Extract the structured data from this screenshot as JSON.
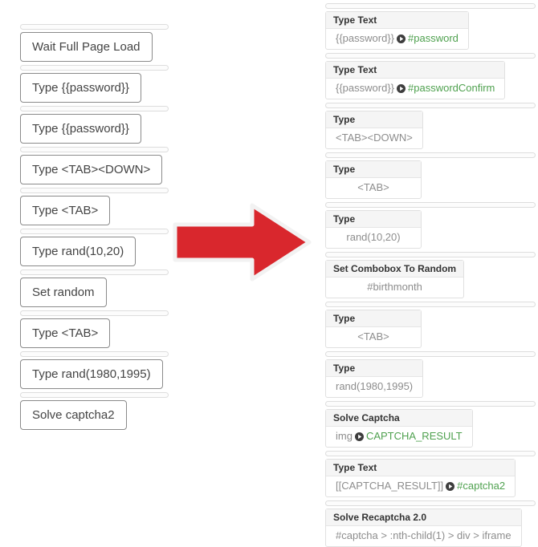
{
  "left_panel": {
    "name": "simple-step-list",
    "steps": [
      {
        "label": "Wait Full Page Load"
      },
      {
        "label": "Type {{password}}"
      },
      {
        "label": "Type {{password}}"
      },
      {
        "label": "Type <TAB><DOWN>"
      },
      {
        "label": "Type <TAB>"
      },
      {
        "label": "Type rand(10,20)"
      },
      {
        "label": "Set random"
      },
      {
        "label": "Type <TAB>"
      },
      {
        "label": "Type rand(1980,1995)"
      },
      {
        "label": "Solve captcha2"
      }
    ]
  },
  "arrow": {
    "name": "red-right-arrow",
    "direction": "right",
    "color": "#d9272d"
  },
  "right_panel": {
    "name": "detailed-step-list",
    "steps": [
      {
        "title": "Type Text",
        "value": "{{password}}",
        "icon": "arrow-circle-right-icon",
        "selector": "#password"
      },
      {
        "title": "Type Text",
        "value": "{{password}}",
        "icon": "arrow-circle-right-icon",
        "selector": "#passwordConfirm"
      },
      {
        "title": "Type",
        "value": "<TAB><DOWN>",
        "icon": "",
        "selector": ""
      },
      {
        "title": "Type",
        "value": "<TAB>",
        "icon": "",
        "selector": ""
      },
      {
        "title": "Type",
        "value": "rand(10,20)",
        "icon": "",
        "selector": ""
      },
      {
        "title": "Set Combobox To Random",
        "value": "#birthmonth",
        "icon": "",
        "selector": ""
      },
      {
        "title": "Type",
        "value": "<TAB>",
        "icon": "",
        "selector": ""
      },
      {
        "title": "Type",
        "value": "rand(1980,1995)",
        "icon": "",
        "selector": ""
      },
      {
        "title": "Solve Captcha",
        "value": "img",
        "icon": "arrow-circle-right-icon",
        "selector": "CAPTCHA_RESULT"
      },
      {
        "title": "Type Text",
        "value": "[[CAPTCHA_RESULT]]",
        "icon": "arrow-circle-right-icon",
        "selector": "#captcha2"
      },
      {
        "title": "Solve Recaptcha 2.0",
        "value": "#captcha > :nth-child(1) > div > iframe",
        "icon": "",
        "selector": ""
      }
    ]
  },
  "colors": {
    "selector_green": "#4fa14f",
    "value_gray": "#8d8d8d",
    "header_bg": "#f5f5f5",
    "arrow_red": "#d9272d"
  }
}
